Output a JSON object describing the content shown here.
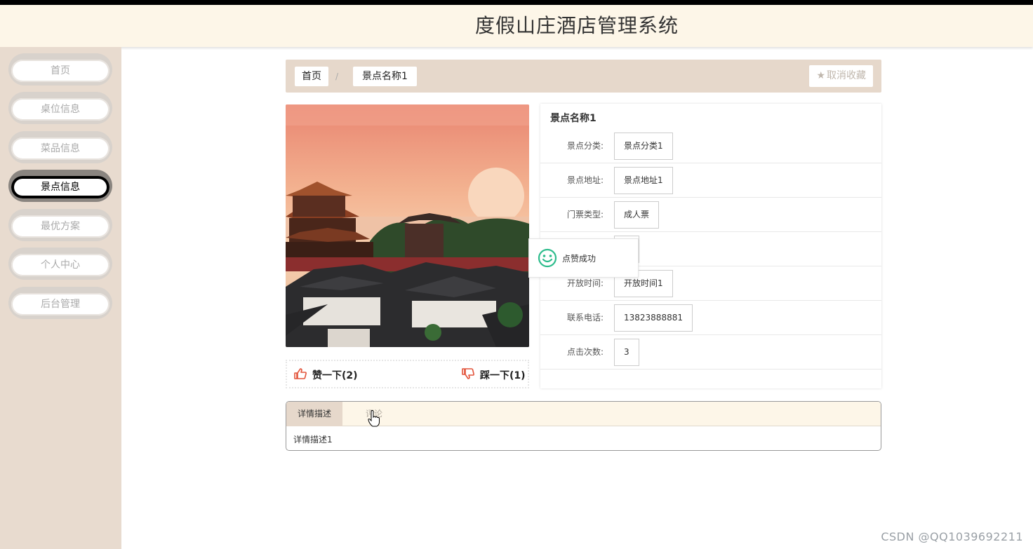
{
  "header": {
    "title": "度假山庄酒店管理系统"
  },
  "sidebar": {
    "items": [
      {
        "label": "首页",
        "active": false
      },
      {
        "label": "桌位信息",
        "active": false
      },
      {
        "label": "菜品信息",
        "active": false
      },
      {
        "label": "景点信息",
        "active": true
      },
      {
        "label": "最优方案",
        "active": false
      },
      {
        "label": "个人中心",
        "active": false
      },
      {
        "label": "后台管理",
        "active": false
      }
    ]
  },
  "breadcrumb": {
    "home": "首页",
    "separator": "/",
    "current": "景点名称1",
    "favorite_label": "取消收藏"
  },
  "vote": {
    "like_label": "赞一下(2)",
    "dislike_label": "踩一下(1)"
  },
  "detail": {
    "name": "景点名称1",
    "fields": [
      {
        "label": "景点分类:",
        "value": "景点分类1"
      },
      {
        "label": "景点地址:",
        "value": "景点地址1"
      },
      {
        "label": "门票类型:",
        "value": "成人票"
      },
      {
        "label": "",
        "value": ""
      },
      {
        "label": "开放时间:",
        "value": "开放时间1"
      },
      {
        "label": "联系电话:",
        "value": "13823888881"
      },
      {
        "label": "点击次数:",
        "value": "3"
      }
    ]
  },
  "toast": {
    "message": "点赞成功"
  },
  "tabs": {
    "items": [
      {
        "label": "详情描述",
        "active": true
      },
      {
        "label": "评论",
        "active": false
      }
    ],
    "content": "详情描述1"
  },
  "watermark": "CSDN @QQ1039692211",
  "colors": {
    "header_bg": "#fdf6e8",
    "sidebar_bg": "#e8dbcf",
    "breadcrumb_bg": "#e6d8cb",
    "vote_icon": "#e2533a",
    "toast_icon": "#2dbc8c"
  }
}
